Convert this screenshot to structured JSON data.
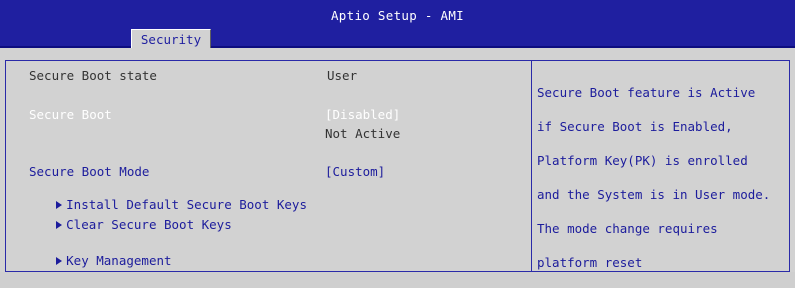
{
  "header": {
    "title": "Aptio Setup - AMI",
    "active_tab": "Security"
  },
  "settings": {
    "secure_boot_state": {
      "label": "Secure Boot state",
      "value": "User"
    },
    "secure_boot": {
      "label": "Secure Boot",
      "value": "[Disabled]",
      "status": "Not Active"
    },
    "secure_boot_mode": {
      "label": "Secure Boot Mode",
      "value": "[Custom]"
    },
    "install_default_keys": {
      "label": "Install Default Secure Boot Keys"
    },
    "clear_keys": {
      "label": "Clear Secure Boot Keys"
    },
    "key_management": {
      "label": "Key Management"
    }
  },
  "help": {
    "lines": [
      "Secure Boot feature is Active",
      "if Secure Boot is Enabled,",
      "Platform Key(PK) is enrolled",
      "and the System is in User mode.",
      "The mode change requires",
      "platform reset"
    ]
  },
  "colors": {
    "header_bg": "#1f1fa0",
    "panel_bg": "#d2d2d2",
    "accent_text": "#1c1c9c",
    "selected_text": "#ffffff"
  }
}
